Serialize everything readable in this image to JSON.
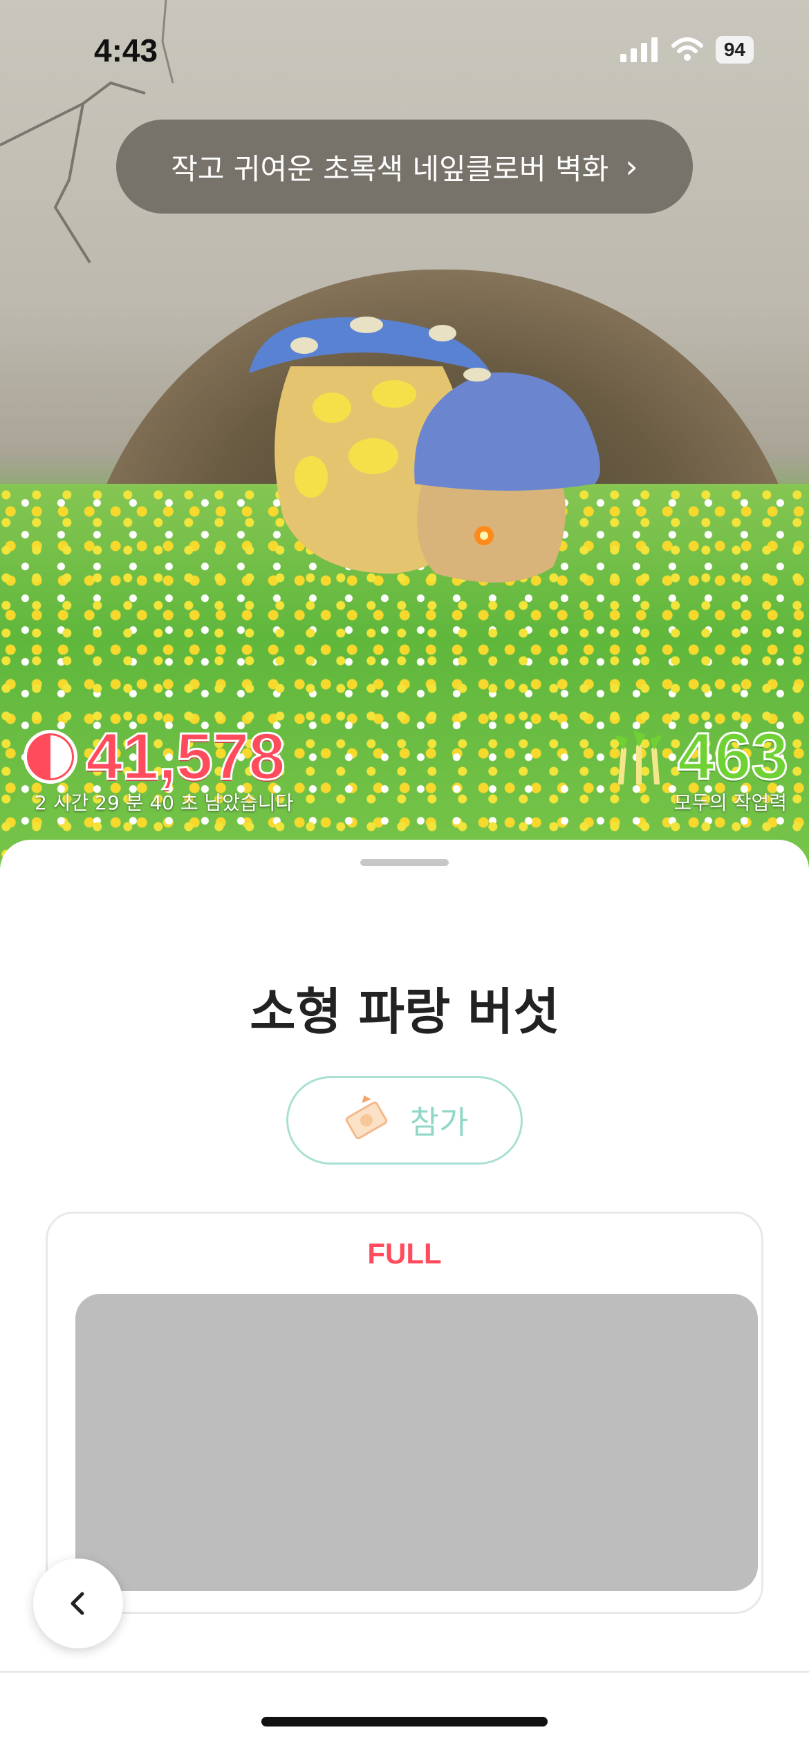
{
  "status_bar": {
    "time": "4:43",
    "battery": "94"
  },
  "banner": {
    "text": "작고 귀여운 초록색 네잎클로버 벽화",
    "chevron": "›"
  },
  "counters": {
    "left_value": "41,578",
    "left_caption": "2 시간 29 분 40 초 남았습니다",
    "left_icon": "half-circle-timer-icon",
    "right_value": "463",
    "right_caption": "모두의 작업력",
    "right_icon": "pikmin-icon"
  },
  "sheet": {
    "title": "소형 파랑 버섯",
    "join_label": "참가",
    "join_icon": "ticket-icon",
    "card_status": "FULL",
    "back_icon": "chevron-left-icon"
  },
  "colors": {
    "accent_red": "#ff4b5b",
    "accent_green": "#6fd133",
    "join_border": "#a9e0d3"
  }
}
